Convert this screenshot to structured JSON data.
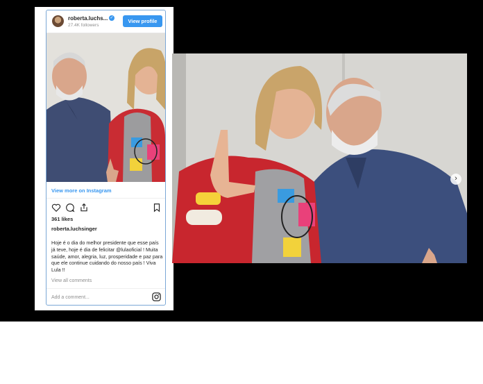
{
  "instagram_post": {
    "username": "roberta.luchs...",
    "followers": "27.4K followers",
    "view_profile_label": "View profile",
    "view_more_label": "View more on Instagram",
    "likes": "361 likes",
    "author": "roberta.luchsinger",
    "caption": "Hoje é o dia do melhor presidente que esse país já teve, hoje é dia de felicitar @lulaoficial ! Muita saúde, amor, alegria, luz, prosperidade e paz para que ele continue cuidando do nosso país ! Viva Lula !!",
    "view_all_comments": "View all comments",
    "add_comment_placeholder": "Add a comment...",
    "icons": [
      "heart-icon",
      "comment-icon",
      "share-icon",
      "bookmark-icon",
      "instagram-logo-icon",
      "verified-badge-icon"
    ],
    "accent_color": "#3897f0"
  },
  "large_photo": {
    "carousel_icon": "chevron-right-icon"
  }
}
